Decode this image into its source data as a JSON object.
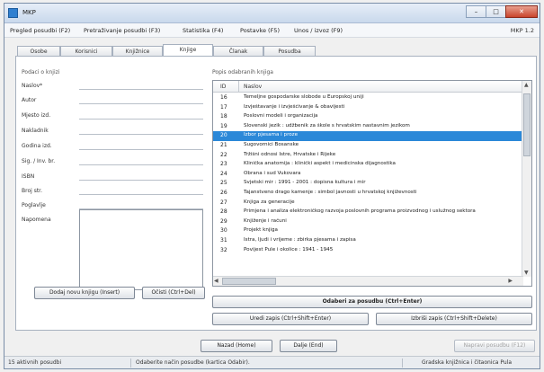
{
  "window": {
    "title": "MKP",
    "version": "MKP 1.2",
    "controls": {
      "minimize": "–",
      "maximize": "□",
      "close": "✕"
    }
  },
  "menu": [
    "Pregled posudbi (F2)",
    "Pretraživanje posudbi (F3)",
    "Statistika (F4)",
    "Postavke (F5)",
    "Unos / izvoz (F9)"
  ],
  "tabs": [
    "Osobe",
    "Korisnici",
    "Knjižnice",
    "Knjige",
    "Članak",
    "Posudba"
  ],
  "active_tab": "Knjige",
  "form": {
    "group_title": "Podaci o knjizi",
    "fields": [
      "Naslov*",
      "Autor",
      "Mjesto izd.",
      "Nakladnik",
      "Godina izd.",
      "Sig. / Inv. br.",
      "ISBN",
      "Broj str.",
      "Poglavlje",
      "Napomena"
    ],
    "add_button": "Dodaj novu knjigu (Insert)",
    "clear_button": "Očisti (Ctrl+Del)"
  },
  "list": {
    "group_title": "Popis odabranih knjiga",
    "columns": {
      "id": "ID",
      "name": "Naslov"
    },
    "rows": [
      {
        "id": "16",
        "name": "Temeljne gospodarske slobode u Europskoj uniji"
      },
      {
        "id": "17",
        "name": "Izvještavanje i izvješćivanje & obavijesti"
      },
      {
        "id": "18",
        "name": "Poslovni modeli i organizacija"
      },
      {
        "id": "19",
        "name": "Slovenski jezik : udžbenik za škole s hrvatskim nastavnim jezikom"
      },
      {
        "id": "20",
        "name": "Izbor pjesama i proze"
      },
      {
        "id": "21",
        "name": "Sugovornici Bosanske"
      },
      {
        "id": "22",
        "name": "Tržišni odnosi Istre, Hrvatske i Rijeke"
      },
      {
        "id": "23",
        "name": "Klinička anatomija : klinički aspekt i medicinska dijagnostika"
      },
      {
        "id": "24",
        "name": "Obrana i sud Vukovara"
      },
      {
        "id": "25",
        "name": "Svjetski mir : 1991 - 2001 : dopisna kultura i mir"
      },
      {
        "id": "26",
        "name": "Tajanstveno drago kamenje : simbol javnosti u hrvatskoj književnosti"
      },
      {
        "id": "27",
        "name": "Knjiga za generacije"
      },
      {
        "id": "28",
        "name": "Primjena i analiza elektroničkog razvoja poslovnih programa proizvodnog i uslužnog sektora"
      },
      {
        "id": "29",
        "name": "Knjiženje i računi"
      },
      {
        "id": "30",
        "name": "Projekt knjiga"
      },
      {
        "id": "31",
        "name": "Istra, ljudi i vrijeme : zbirka pjesama i zapisa"
      },
      {
        "id": "32",
        "name": "Povijest Pule i okolice : 1941 - 1945"
      }
    ],
    "selected_row": "20"
  },
  "buttons": {
    "select_for_loan": "Odaberi za posudbu (Ctrl+Enter)",
    "edit": "Uredi zapis (Ctrl+Shift+Enter)",
    "delete": "Izbriši zapis (Ctrl+Shift+Delete)",
    "back": "Nazad (Home)",
    "next": "Dalje (End)",
    "finish": "Napravi posudbu (F12)"
  },
  "status": {
    "active_loans": "15 aktivnih posudbi",
    "hint": "Odaberite način posudbe (kartica Odabir).",
    "library": "Gradska knjižnica i čitaonica Pula"
  },
  "colors": {
    "selection": "#2b88d8",
    "title_bar": "#c9d9ec"
  }
}
